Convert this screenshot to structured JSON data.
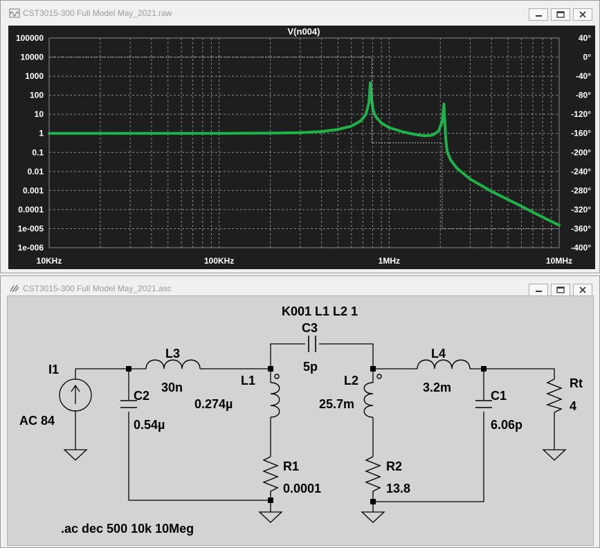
{
  "plot_window": {
    "title": "CST3015-300 Full Model May_2021.raw",
    "icon": "waveform-icon"
  },
  "schematic_window": {
    "title": "CST3015-300 Full Model May_2021.asc",
    "icon": "schematic-icon"
  },
  "colors": {
    "plot_bg": "#1e1e1e",
    "grid": "#8a8a8a",
    "trace": "#1fb14a",
    "phase": "#b8b8b8",
    "schematic_bg": "#d3d3d3"
  },
  "chart_data": {
    "type": "line",
    "title": "V(n004)",
    "x_scale": "log",
    "y_scale": "log",
    "xlim": [
      10000,
      10000000
    ],
    "ylim": [
      1e-06,
      100000
    ],
    "y2lim": [
      -400,
      40
    ],
    "x_ticks": [
      {
        "value": 10000,
        "label": "10KHz"
      },
      {
        "value": 100000,
        "label": "100KHz"
      },
      {
        "value": 1000000,
        "label": "1MHz"
      },
      {
        "value": 10000000,
        "label": "10MHz"
      }
    ],
    "y_ticks": [
      {
        "value": 100000,
        "label": "100000"
      },
      {
        "value": 10000,
        "label": "10000"
      },
      {
        "value": 1000,
        "label": "1000"
      },
      {
        "value": 100,
        "label": "100"
      },
      {
        "value": 10,
        "label": "10"
      },
      {
        "value": 1,
        "label": "1"
      },
      {
        "value": 0.1,
        "label": "0.1"
      },
      {
        "value": 0.01,
        "label": "0.01"
      },
      {
        "value": 0.001,
        "label": "0.001"
      },
      {
        "value": 0.0001,
        "label": "0.0001"
      },
      {
        "value": 1e-05,
        "label": "1e-005"
      },
      {
        "value": 1e-06,
        "label": "1e-006"
      }
    ],
    "y2_ticks": [
      {
        "value": 40,
        "label": "40°"
      },
      {
        "value": 0,
        "label": "0°"
      },
      {
        "value": -40,
        "label": "-40°"
      },
      {
        "value": -80,
        "label": "-80°"
      },
      {
        "value": -120,
        "label": "-120°"
      },
      {
        "value": -160,
        "label": "-160°"
      },
      {
        "value": -200,
        "label": "-200°"
      },
      {
        "value": -240,
        "label": "-240°"
      },
      {
        "value": -280,
        "label": "-280°"
      },
      {
        "value": -320,
        "label": "-320°"
      },
      {
        "value": -360,
        "label": "-360°"
      },
      {
        "value": -400,
        "label": "-400°"
      }
    ],
    "grid": true,
    "series": [
      {
        "name": "V(n004)",
        "axis": "magnitude",
        "x": [
          10000,
          100000,
          200000,
          300000,
          400000,
          500000,
          600000,
          680000,
          730000,
          760000,
          775000,
          785000,
          795000,
          805000,
          820000,
          850000,
          900000,
          1000000,
          1200000,
          1400000,
          1600000,
          1800000,
          1950000,
          2050000,
          2100000,
          2130000,
          2150000,
          2170000,
          2200000,
          2300000,
          2500000,
          3000000,
          4000000,
          6000000,
          8000000,
          10000000
        ],
        "y": [
          1.0,
          1.0,
          1.03,
          1.08,
          1.25,
          1.6,
          2.4,
          4.5,
          10,
          40,
          450,
          100,
          35,
          18,
          10,
          6,
          3.5,
          2,
          1.2,
          0.9,
          0.75,
          0.8,
          1.3,
          4,
          35,
          3,
          0.6,
          0.25,
          0.1,
          0.04,
          0.015,
          0.004,
          0.0009,
          0.00015,
          4e-05,
          1.5e-05
        ]
      },
      {
        "name": "phase",
        "axis": "phase",
        "x": [
          10000,
          790000,
          790000,
          2050000,
          2050000,
          10000000
        ],
        "y": [
          0,
          0,
          -180,
          -180,
          -360,
          -360
        ]
      }
    ]
  },
  "schematic": {
    "directive_coupling": "K001 L1 L2 1",
    "directive_sim": ".ac dec 500 10k 10Meg",
    "components": {
      "I1": {
        "name": "I1",
        "value": "AC 84"
      },
      "C2": {
        "name": "C2",
        "value": "0.54µ"
      },
      "L3": {
        "name": "L3",
        "value": "30n"
      },
      "L1": {
        "name": "L1",
        "value": "0.274µ"
      },
      "R1": {
        "name": "R1",
        "value": "0.0001"
      },
      "C3": {
        "name": "C3",
        "value": "5p"
      },
      "L2": {
        "name": "L2",
        "value": "25.7m"
      },
      "R2": {
        "name": "R2",
        "value": "13.8"
      },
      "L4": {
        "name": "L4",
        "value": "3.2m"
      },
      "C1": {
        "name": "C1",
        "value": "6.06p"
      },
      "Rt": {
        "name": "Rt",
        "value": "4"
      }
    }
  }
}
